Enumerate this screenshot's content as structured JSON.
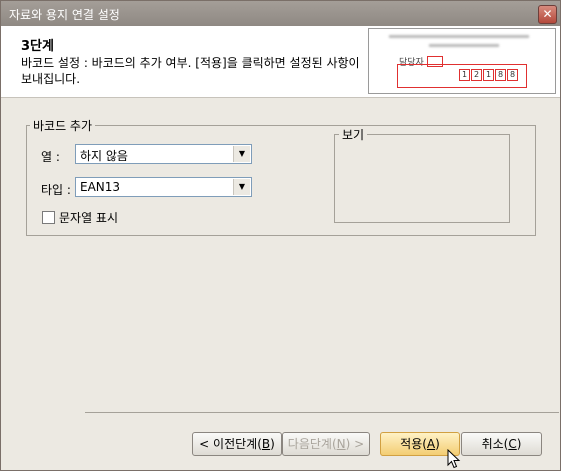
{
  "window": {
    "title": "자료와 용지 연결 설정",
    "close_icon": "close-icon"
  },
  "header": {
    "step": "3단계",
    "description": "바코드 설정 : 바코드의 추가 여부. [적용]을 클릭하면 설정된 사항이 보내집니다.",
    "preview_label": "담당자",
    "preview_digits": [
      "1",
      "2",
      "1",
      "8",
      "8"
    ]
  },
  "barcode_group": {
    "legend": "바코드 추가",
    "column_label": "열 :",
    "column_value": "하지 않음",
    "type_label": "타입 :",
    "type_value": "EAN13",
    "show_text_label": "문자열 표시",
    "show_text_checked": false
  },
  "preview_group": {
    "legend": "보기"
  },
  "buttons": {
    "prev": "< 이전단계(",
    "prev_key": "B",
    "next": "다음단계(",
    "next_key": "N",
    "next_suffix": ") >",
    "apply": "적용(",
    "apply_key": "A",
    "cancel": "취소(",
    "cancel_key": "C",
    "close_paren": ")"
  },
  "colors": {
    "titlebar": "#9a948e",
    "focus_button": "#f3cd73",
    "barcode_red": "#e03030"
  }
}
